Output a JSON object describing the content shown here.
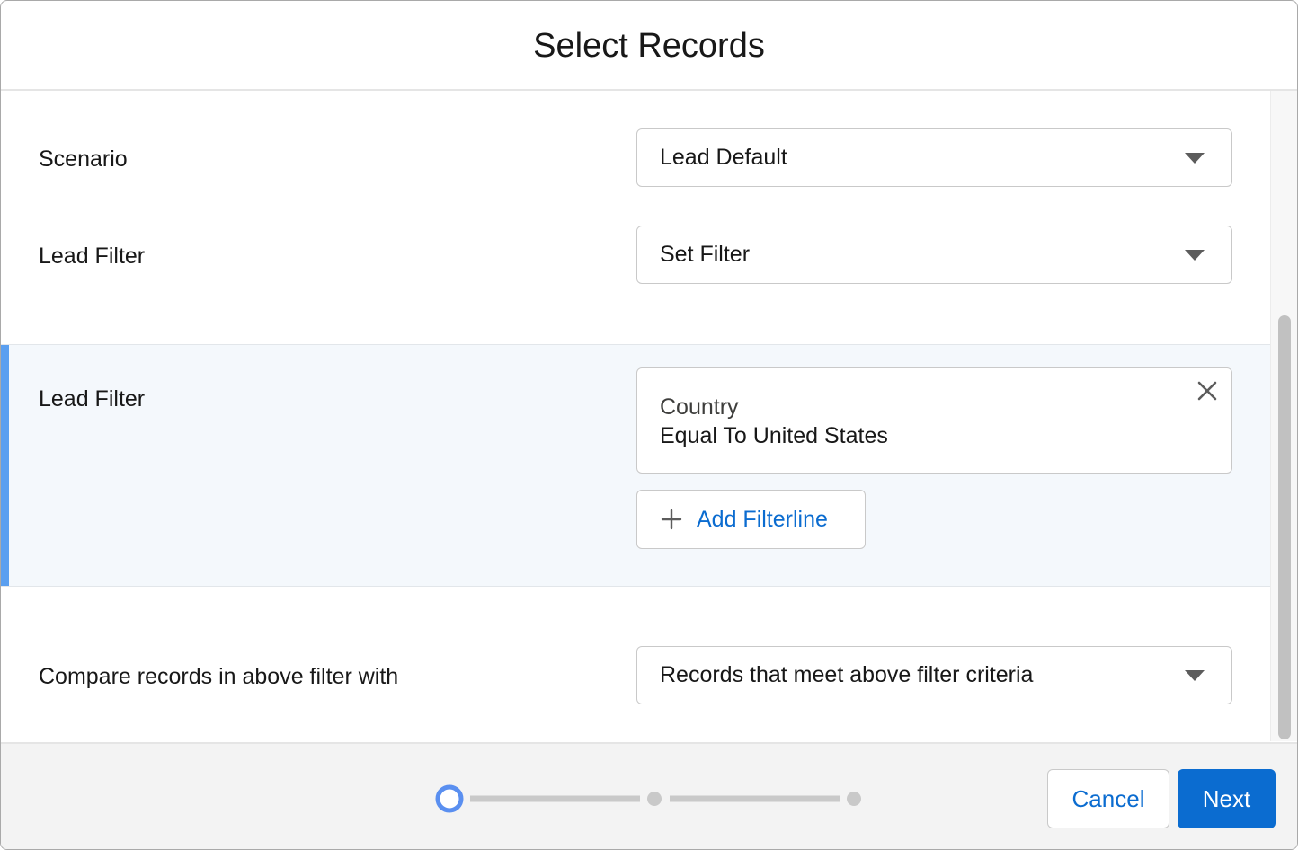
{
  "modal": {
    "title": "Select Records"
  },
  "form": {
    "scenario": {
      "label": "Scenario",
      "value": "Lead Default"
    },
    "lead_filter_select": {
      "label": "Lead Filter",
      "value": "Set Filter"
    },
    "lead_filter_section": {
      "label": "Lead Filter",
      "filterlines": [
        {
          "field": "Country",
          "condition": "Equal To United States"
        }
      ],
      "add_label": "Add Filterline"
    },
    "compare": {
      "label": "Compare records in above filter with",
      "value": "Records that meet above filter criteria"
    }
  },
  "footer": {
    "progress": {
      "current_step": 1,
      "total_steps": 3
    },
    "cancel_label": "Cancel",
    "next_label": "Next"
  },
  "colors": {
    "accent": "#0b6cd0",
    "filter_highlight_bar": "#5a9ff0",
    "filter_section_bg": "#f4f8fc",
    "footer_bg": "#f3f3f3",
    "progress_active": "#5a8ff0",
    "progress_inactive": "#c9c9c9"
  }
}
